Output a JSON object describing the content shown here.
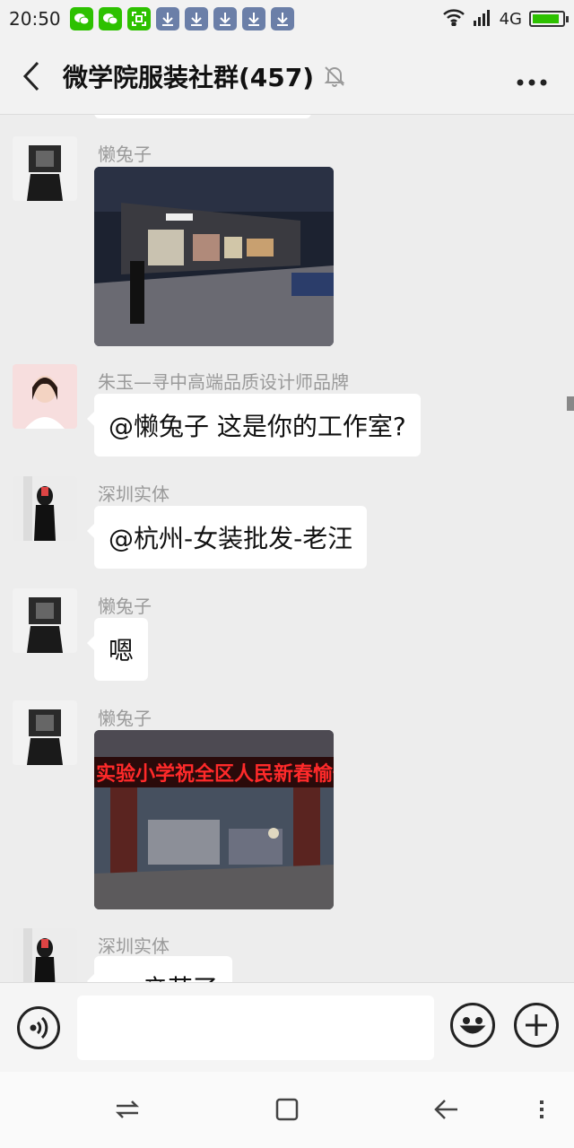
{
  "status_bar": {
    "time": "20:50",
    "network": "4G",
    "battery_level": 0.9,
    "notification_icons": [
      "wechat-icon",
      "wechat-icon",
      "scan-icon",
      "download-icon",
      "download-icon",
      "download-icon",
      "download-icon",
      "download-icon"
    ]
  },
  "header": {
    "title": "微学院服装社群(457)",
    "muted": true,
    "back_icon": "chevron-left-icon",
    "more_icon": "more-dots-icon"
  },
  "messages": [
    {
      "sender": "懒兔子",
      "type": "image",
      "image_desc": "night street storefront photo"
    },
    {
      "sender": "朱玉—寻中高端品质设计师品牌",
      "type": "text",
      "text": "@懒兔子  这是你的工作室?"
    },
    {
      "sender": "深圳实体",
      "type": "text",
      "text": "@杭州-女装批发-老汪"
    },
    {
      "sender": "懒兔子",
      "type": "text",
      "text": "嗯"
    },
    {
      "sender": "懒兔子",
      "type": "image",
      "image_desc": "school gate with red LED banner",
      "banner_text": "实验小学祝全区人民新春愉快"
    },
    {
      "sender": "深圳实体",
      "type": "text",
      "text": "辛苦了"
    }
  ],
  "input_bar": {
    "placeholder": "",
    "value": "",
    "voice_icon": "voice-icon",
    "emoji_icon": "emoji-icon",
    "plus_icon": "plus-icon"
  },
  "nav_bar": {
    "icons": [
      "switch-icon",
      "home-square-icon",
      "back-arrow-icon",
      "menu-icon"
    ]
  },
  "colors": {
    "background": "#ededed",
    "bubble": "#ffffff",
    "sender_text": "#9a9a9a",
    "accent_green": "#2dc100"
  }
}
